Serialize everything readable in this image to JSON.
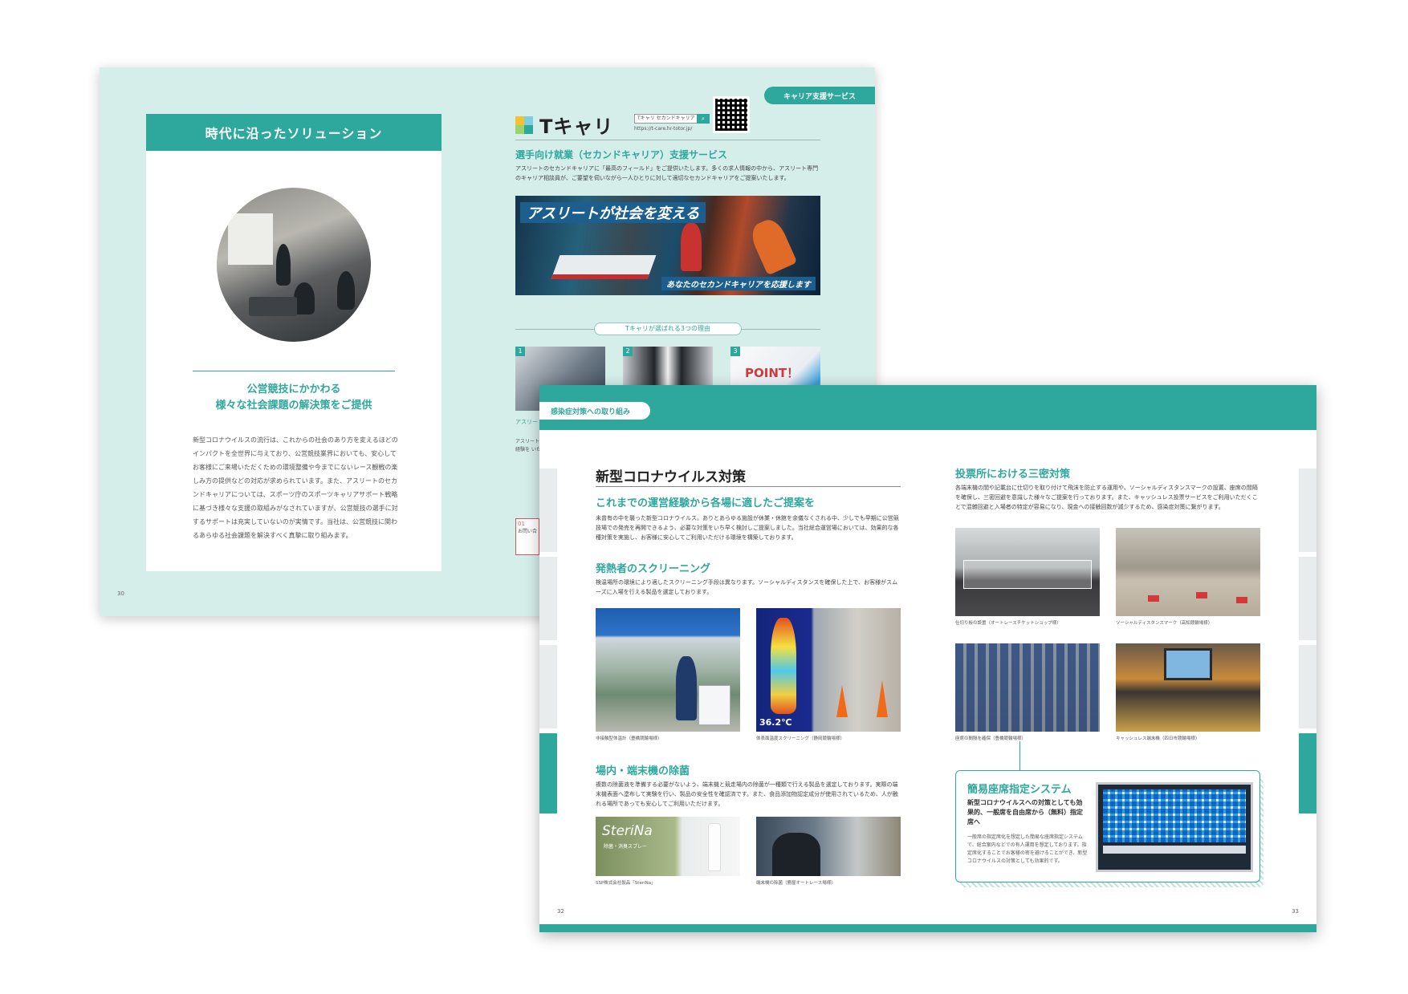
{
  "back_spread": {
    "left_card": {
      "header": "時代に沿ったソリューション",
      "subtitle_line1": "公営競技にかかわる",
      "subtitle_line2": "様々な社会課題の解決策をご提供",
      "body": "新型コロナウイルスの流行は、これからの社会のあり方を変えるほどのインパクトを全世界に与えており、公営競技業界においても、安心してお客様にご来場いただくための環境整備や今までにないレース観戦の楽しみ方の提供などの対応が求められています。また、アスリートのセカンドキャリアについては、スポーツ庁のスポーツキャリアサポート戦略に基づき様々な支援の取組みがなされていますが、公営競技の選手に対するサポートは充実していないのが実情です。当社は、公営競技に関わるあらゆる社会課題を解決すべく真摯に取り組みます。"
    },
    "page_number": "30",
    "career_tag": "キャリア支援サービス",
    "logo_text": "Tキャリ",
    "search_placeholder": "Tキャリ セカンドキャリア",
    "search_icon": "search-icon",
    "url": "https://t-care.hr-totor.jp/",
    "service_title": "選手向け就業（セカンドキャリア）支援サービス",
    "service_desc": "アスリートのセカンドキャリアに「最高のフィールド」をご提供いたします。多くの求人情報の中から、アスリート専門のキャリア相談員が、ご要望を伺いながら一人ひとりに対して適切なセカンドキャリアをご提案いたします。",
    "banner_headline": "アスリートが社会を変える",
    "banner_tagline": "あなたのセカンドキャリアを応援します",
    "reasons_label": "Tキャリが選ばれる3つの理由",
    "reasons": [
      "1",
      "2",
      "3"
    ],
    "point_text": "POINT！",
    "peek_title": "アスリート キャリア",
    "peek_body": "アスリート キャリア相 な経験を いたしま",
    "peek_num": "01",
    "peek_contact": "お問い合"
  },
  "front_spread": {
    "tag": "感染症対策への取り組み",
    "title": "新型コロナウイルス対策",
    "section1_heading": "これまでの運営経験から各場に適したご提案を",
    "section1_body": "未曾有の中を襲った新型コロナウイルス。ありとあらゆる施設が休業・休館を余儀なくされる中、少しでも早期に公営競技場での発売を再開できるよう、必要な対策をいち早く検討しご提案しました。当社総合運営場においては、効果的な各種対策を実施し、お客様に安心してご利用いただける環境を構築しております。",
    "section2_heading": "発熱者のスクリーニング",
    "section2_body": "検温場所の環境により適したスクリーニング手段は異なります。ソーシャルディスタンスを確保した上で、お客様がスムーズに入場を行える製品を選定しております。",
    "photo1_caption": "非接触型体温計（豊橋競輪場様）",
    "photo2_caption": "体表面温度スクリーニング（静岡競輪場様）",
    "thermal_reading": "36.2℃",
    "section3_heading": "場内・端末機の除菌",
    "section3_body": "複数の除菌液を準備する必要がないよう、端末機と競走場内の除菌が一種類で行える製品を選定しております。実際の端末機表面へ塗布して実験を行い、製品の安全性を確認済です。また、食品添加物認定成分が使用されているため、人が触れる場所であっても安心してご利用いただけます。",
    "sterina_label": "SteriNa",
    "sterina_sub": "除菌・消臭スプレー",
    "photo3_caption": "SSP株式会社製品「SteriNa」",
    "photo4_caption": "端末機の除菌（鹿屋オートレース場様）",
    "section4_heading": "投票所における三密対策",
    "section4_body": "各端末機の間や記載台に仕切りを取り付けて飛沫を防止する運用や、ソーシャルディスタンスマークの設置、座席の間隔を確保し、三密回避を意識した様々なご提案を行っております。また、キャッシュレス投票サービスをご利用いただくことで混雑回避と入場者の特定が容易になり、現金への接触回数が減少するため、感染症対策に繋がります。",
    "photo5_caption": "仕切り板の設置（オートレースチケットショップ様）",
    "photo6_caption": "ソーシャルディスタンスマーク（高知競輪場様）",
    "photo7_caption": "座席の間隔を確保（豊橋競輪場様）",
    "photo8_caption": "キャッシュレス端末機（四日市競輪場様）",
    "seat_box_title": "簡易座席指定システム",
    "seat_box_lead": "新型コロナウイルスへの対策としても効果的、一般席を自由席から（無料）指定席へ",
    "seat_box_body": "一般席の指定席化を想定した簡易な座席指定システムで、総合案内などでの有人運用を想定しております。指定席化することでお客様の密を避けることができ、新型コロナウイルスの対策としても効果的です。",
    "page_left": "32",
    "page_right": "33"
  }
}
